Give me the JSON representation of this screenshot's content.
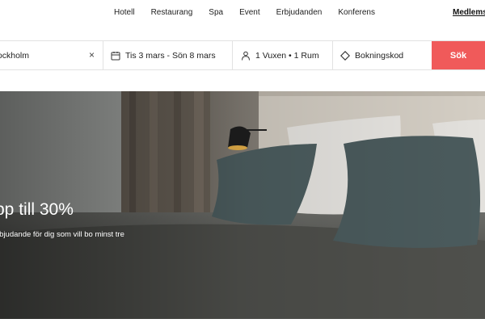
{
  "nav": {
    "links": [
      "Hotell",
      "Restaurang",
      "Spa",
      "Event",
      "Erbjudanden",
      "Konferens"
    ],
    "member_label": "Medlemsl"
  },
  "search": {
    "destination": "tockholm",
    "clear_icon": "close-icon",
    "dates": "Tis 3 mars - Sön 8 mars",
    "guests": "1 Vuxen • 1 Rum",
    "code_placeholder": "Bokningskod",
    "button_label": "Sök",
    "button_color": "#f05a5a"
  },
  "hero": {
    "title": "pp till 30%",
    "subtitle": "rbjudande för dig som vill bo minst tre"
  }
}
